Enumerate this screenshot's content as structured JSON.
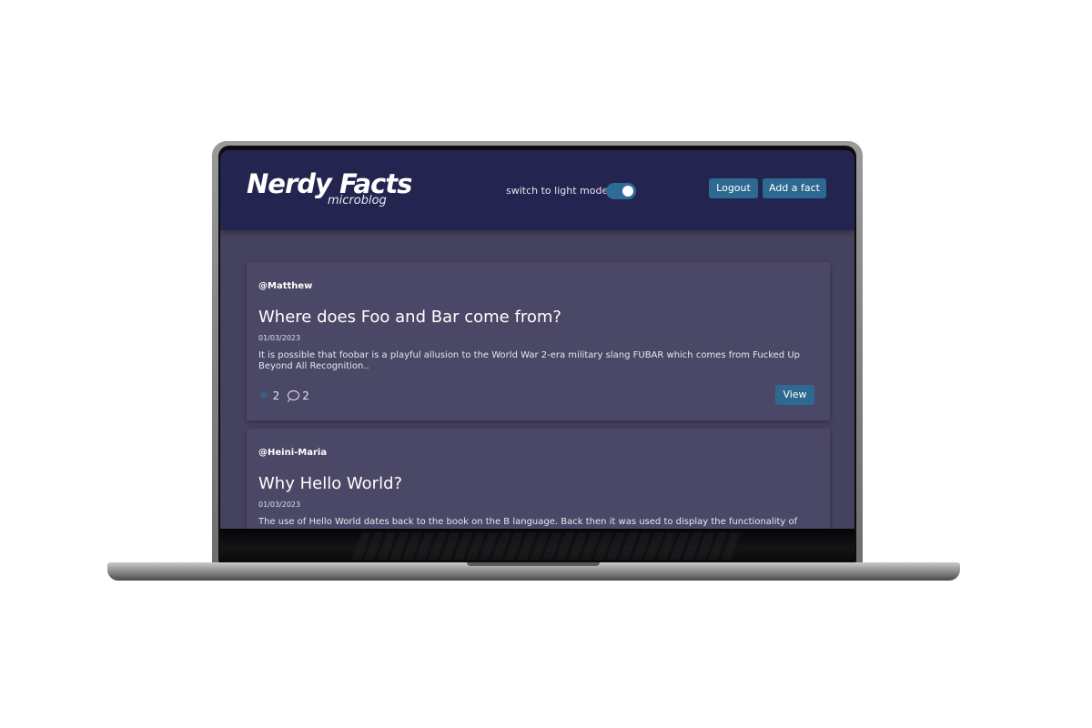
{
  "header": {
    "logo_title": "Nerdy Facts",
    "logo_subtitle": "microblog",
    "theme_toggle_label": "switch to light mode",
    "theme_toggle_on": true,
    "logout_label": "Logout",
    "add_fact_label": "Add a fact"
  },
  "posts": [
    {
      "author": "@Matthew",
      "title": "Where does Foo and Bar come from?",
      "date": "01/03/2023",
      "excerpt": "It is possible that foobar is a playful allusion to the World War 2-era military slang FUBAR which comes from Fucked Up Beyond All Recognition..",
      "stars": "2",
      "comments": "2",
      "view_label": "View"
    },
    {
      "author": "@Heini-Maria",
      "title": "Why Hello World?",
      "date": "01/03/2023",
      "excerpt": "The use of Hello World dates back to the book on the B language. Back then it was used to display the functionality of"
    }
  ],
  "icons": {
    "star": "star-icon",
    "comment": "comment-icon"
  },
  "colors": {
    "header_bg": "#232450",
    "page_bg": "#45425f",
    "card_bg": "#4a4866",
    "accent": "#2d6990"
  }
}
